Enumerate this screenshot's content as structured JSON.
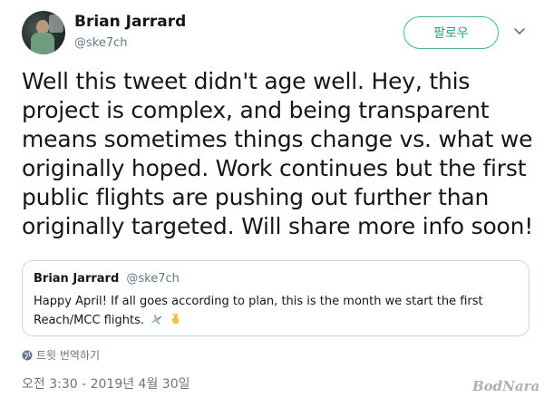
{
  "author": {
    "name": "Brian Jarrard",
    "handle": "@ske7ch"
  },
  "follow_button": {
    "label": "팔로우"
  },
  "tweet": {
    "text": "Well this tweet didn't age well. Hey, this project is complex, and being transparent means sometimes things change vs. what we originally hoped. Work continues but the first public flights are pushing out further than originally targeted. Will share more info soon!"
  },
  "quoted_tweet": {
    "name": "Brian Jarrard",
    "handle": "@ske7ch",
    "text": "Happy April! If all goes according to plan, this is the month we start the first Reach/MCC flights.",
    "emojis": [
      "airplane-icon",
      "crossed-fingers-icon"
    ]
  },
  "translate": {
    "label": "트윗 번역하기"
  },
  "timestamp": "오전 3:30 - 2019년 4월 30일",
  "watermark": "BodNara",
  "colors": {
    "accent": "#4ab3a3",
    "secondary_text": "#657786",
    "border": "#ccd6dd"
  }
}
